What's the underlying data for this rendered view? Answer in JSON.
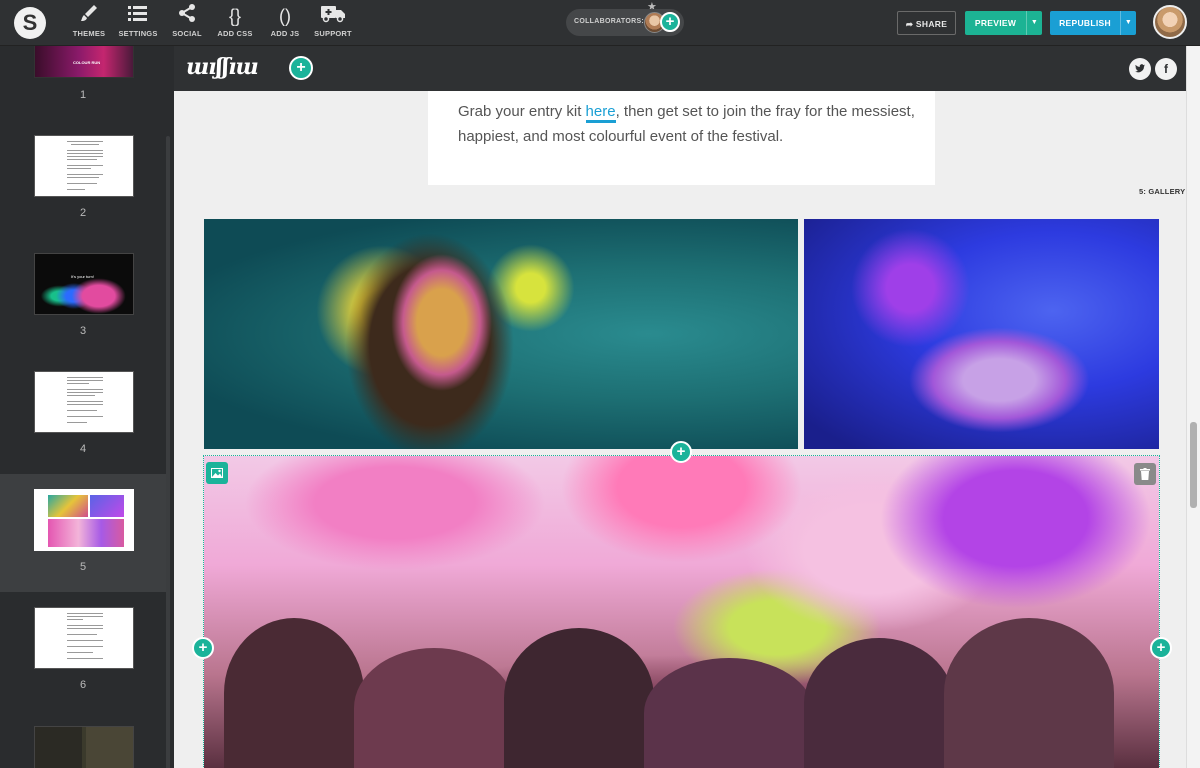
{
  "toolbar": {
    "logo": "S",
    "items": [
      {
        "label": "THEMES",
        "icon": "brush-icon",
        "glyph": "✎"
      },
      {
        "label": "SETTINGS",
        "icon": "list-icon",
        "glyph": "☰"
      },
      {
        "label": "SOCIAL",
        "icon": "share-icon",
        "glyph": "⋖"
      },
      {
        "label": "ADD CSS",
        "icon": "braces-icon",
        "glyph": "{}"
      },
      {
        "label": "ADD JS",
        "icon": "parentheses-icon",
        "glyph": "()"
      },
      {
        "label": "SUPPORT",
        "icon": "ambulance-icon",
        "glyph": "⛟"
      }
    ],
    "collaborators_label": "COLLABORATORS:",
    "share_label": "SHARE",
    "preview_label": "PREVIEW",
    "republish_label": "REPUBLISH"
  },
  "sidebar": {
    "slides": [
      "1",
      "2",
      "3",
      "4",
      "5",
      "6"
    ],
    "active": "5",
    "thumb1_title": "COLOUR RUN",
    "thumb3_title": "It's your turn!"
  },
  "editor": {
    "site_logo": "ɯıʃʃıɯ",
    "text_before_link": "Grab your entry kit ",
    "link_text": "here",
    "text_after_link": ", then get set to join the fray for the messiest, happiest, and most colourful event of the festival.",
    "section_tag": "5: GALLERY",
    "social": [
      "twitter-icon",
      "facebook-icon"
    ]
  },
  "colors": {
    "toolbar_bg": "#2f3133",
    "accent_green": "#1bb39a",
    "accent_blue": "#1a9fd4",
    "link": "#1a9fd4"
  }
}
